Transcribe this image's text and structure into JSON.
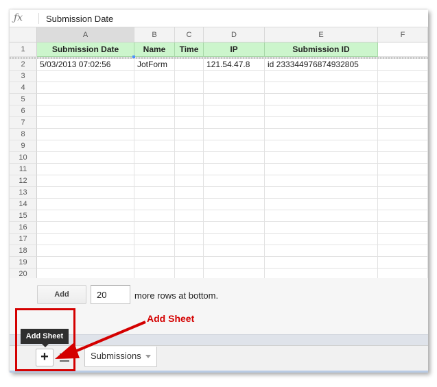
{
  "formula_bar": {
    "icon": "fx-icon",
    "label": "ƒx",
    "value": "Submission Date"
  },
  "columns": [
    "A",
    "B",
    "C",
    "D",
    "E",
    "F"
  ],
  "rows": [
    "1",
    "2",
    "3",
    "4",
    "5",
    "6",
    "7",
    "8",
    "9",
    "10",
    "11",
    "12",
    "13",
    "14",
    "15",
    "16",
    "17",
    "18",
    "19",
    "20"
  ],
  "header_row": [
    "Submission Date",
    "Name",
    "Time",
    "IP",
    "Submission ID",
    ""
  ],
  "data_rows": [
    [
      "5/03/2013 07:02:56",
      "JotForm",
      "",
      "121.54.47.8",
      "id 233344976874932805",
      ""
    ]
  ],
  "add_rows": {
    "button_label": "Add",
    "input_value": "20",
    "suffix": "more rows at bottom."
  },
  "sheet_bar": {
    "add_sheet_tooltip": "Add Sheet",
    "plus_label": "+",
    "tabs": [
      {
        "label": "Submissions"
      }
    ]
  },
  "annotation": {
    "label": "Add Sheet",
    "color": "#d40000"
  },
  "colors": {
    "header_fill": "#ccf5cc",
    "accent": "#4d90fe"
  }
}
